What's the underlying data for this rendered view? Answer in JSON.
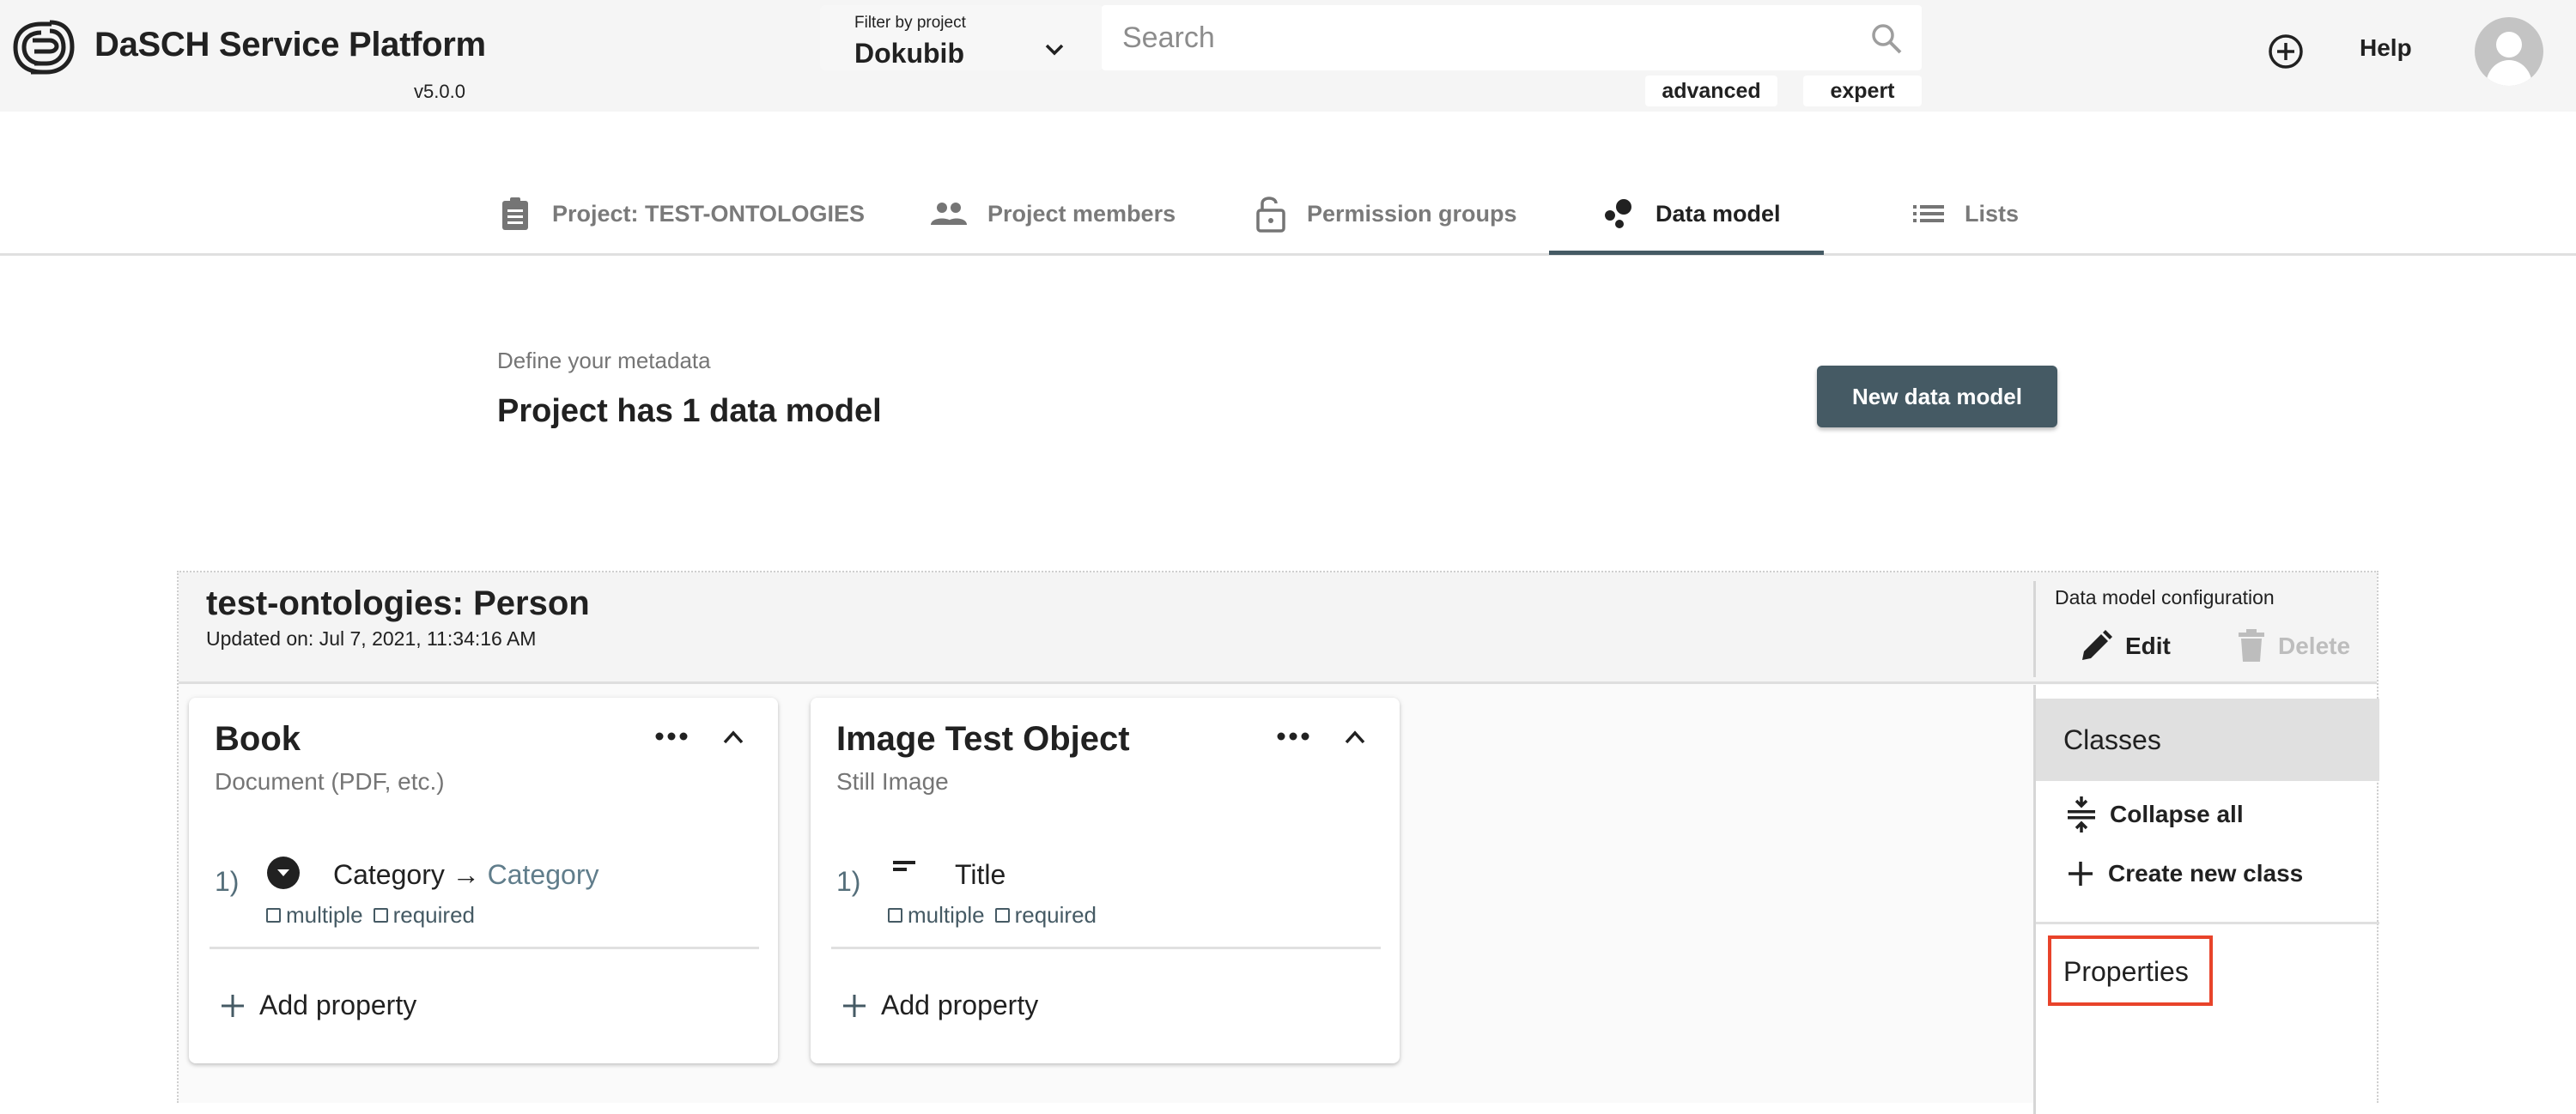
{
  "header": {
    "app_title": "DaSCH Service Platform",
    "version": "v5.0.0",
    "logo_icon": "dasch-logo-icon",
    "project_filter": {
      "label": "Filter by project",
      "selected": "Dokubib"
    },
    "search": {
      "placeholder": "Search",
      "value": ""
    },
    "search_modes": [
      "advanced",
      "expert"
    ],
    "add_icon": "add-circle-icon",
    "help_label": "Help",
    "avatar_icon": "user-avatar-icon"
  },
  "tabs": [
    {
      "label": "Project: TEST-ONTOLOGIES",
      "icon": "clipboard-icon",
      "active": false
    },
    {
      "label": "Project members",
      "icon": "people-icon",
      "active": false
    },
    {
      "label": "Permission groups",
      "icon": "lock-open-icon",
      "active": false
    },
    {
      "label": "Data model",
      "icon": "bubble-chart-icon",
      "active": true
    },
    {
      "label": "Lists",
      "icon": "list-icon",
      "active": false
    }
  ],
  "intro": {
    "label": "Define your metadata",
    "title": "Project has 1 data model",
    "new_button": "New data model"
  },
  "ontology": {
    "title": "test-ontologies: Person",
    "updated": "Updated on: Jul 7, 2021, 11:34:16 AM",
    "config": {
      "label": "Data model configuration",
      "edit_label": "Edit",
      "delete_label": "Delete",
      "delete_disabled": true
    },
    "classes": [
      {
        "title": "Book",
        "subtitle": "Document (PDF, etc.)",
        "properties": [
          {
            "index": "1)",
            "icon": "list-dropdown-icon",
            "name": "Category",
            "arrow": "→",
            "target": "Category",
            "multiple": "multiple",
            "required": "required"
          }
        ],
        "add_property_label": "Add property"
      },
      {
        "title": "Image Test Object",
        "subtitle": "Still Image",
        "properties": [
          {
            "index": "1)",
            "icon": "short-text-icon",
            "name": "Title",
            "arrow": "",
            "target": "",
            "multiple": "multiple",
            "required": "required"
          }
        ],
        "add_property_label": "Add property"
      }
    ],
    "sidebar": {
      "classes_label": "Classes",
      "collapse_all_label": "Collapse all",
      "create_class_label": "Create new class",
      "properties_label": "Properties",
      "highlight_color": "#e8432a"
    }
  }
}
